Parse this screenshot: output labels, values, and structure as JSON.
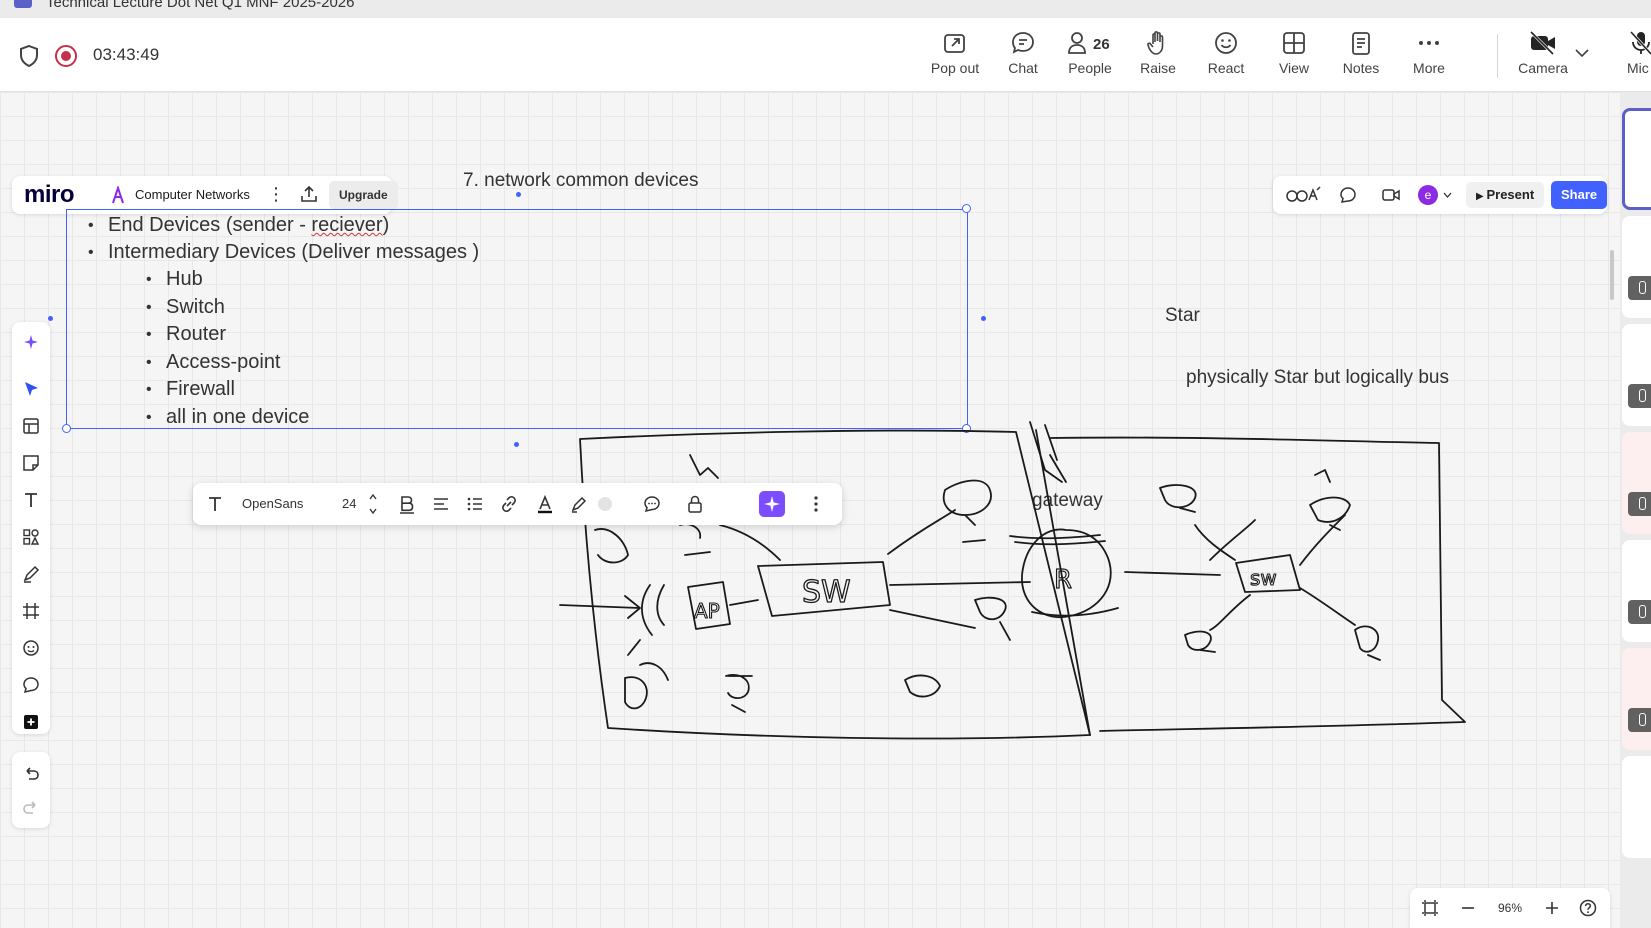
{
  "teams": {
    "window_title": "Technical Lecture Dot Net Q1 MNF 2025-2026",
    "timer": "03:43:49",
    "toolbar": [
      {
        "label": "Pop out",
        "icon": "popout-icon"
      },
      {
        "label": "Chat",
        "icon": "chat-icon"
      },
      {
        "label": "People",
        "icon": "people-icon",
        "count": "26"
      },
      {
        "label": "Raise",
        "icon": "raise-hand-icon"
      },
      {
        "label": "React",
        "icon": "react-icon"
      },
      {
        "label": "View",
        "icon": "view-icon"
      },
      {
        "label": "Notes",
        "icon": "notes-icon"
      },
      {
        "label": "More",
        "icon": "more-icon"
      },
      {
        "label": "Camera",
        "icon": "camera-off-icon"
      },
      {
        "label": "Mic",
        "icon": "mic-off-icon"
      }
    ]
  },
  "miro": {
    "logo": "miro",
    "board_name": "Computer Networks",
    "upgrade_label": "Upgrade",
    "avatar_initial": "e",
    "present_label": "Present",
    "share_label": "Share",
    "font_name": "OpenSans",
    "font_size": "24",
    "zoom": "96%"
  },
  "content": {
    "heading": "7. network common devices",
    "bullets": [
      "End Devices (sender - reciever)",
      "Intermediary Devices (Deliver messages )"
    ],
    "sub_bullets": [
      "Hub",
      "Switch",
      "Router",
      "Access-point",
      "Firewall",
      "all in one device"
    ],
    "star_label": "Star",
    "physical_label": "physically Star but logically bus",
    "gateway_label": "gateway",
    "sketch_labels": [
      "AP",
      "SW",
      "R",
      "sw"
    ]
  },
  "colors": {
    "accent": "#4262ff",
    "teams": "#5b5fc7",
    "record": "#c4314b"
  }
}
